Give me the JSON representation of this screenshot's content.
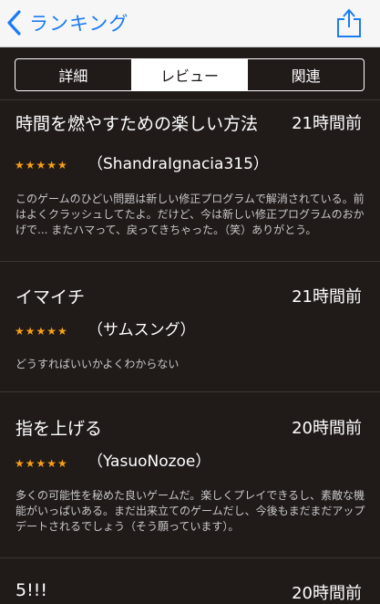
{
  "nav": {
    "back_label": "ランキング",
    "accent_color": "#1a7cf5"
  },
  "tabs": [
    {
      "label": "詳細",
      "active": false
    },
    {
      "label": "レビュー",
      "active": true
    },
    {
      "label": "関連",
      "active": false
    }
  ],
  "reviews": [
    {
      "title": "時間を燃やすための楽しい方法",
      "date": "21時間前",
      "stars": "★★★★★",
      "rating": 5,
      "author": "（ShandraIgnacia315）",
      "body": "このゲームのひどい問題は新しい修正プログラムで解消されている。前はよくクラッシュしてたよ。だけど、今は新しい修正プログラムのおかげで... またハマって、戻ってきちゃった。（笑）ありがとう。"
    },
    {
      "title": "イマイチ",
      "date": "21時間前",
      "stars": "★★★★★",
      "rating": 5,
      "author": "（サムスング）",
      "body": "どうすればいいかよくわからない"
    },
    {
      "title": "指を上げる",
      "date": "20時間前",
      "stars": "★★★★★",
      "rating": 5,
      "author": "（YasuoNozoe）",
      "body": "多くの可能性を秘めた良いゲームだ。楽しくプレイできるし、素敵な機能がいっぱいある。まだ出来立てのゲームだし、今後もまだまだアップデートされるでしょう（そう願っています）。"
    },
    {
      "title": "5!!!",
      "date": "20時間前",
      "stars": "",
      "rating": null,
      "author": "",
      "body": ""
    }
  ],
  "colors": {
    "background": "#201a19",
    "star": "#f7a016",
    "body_text": "#c8c8c8"
  }
}
